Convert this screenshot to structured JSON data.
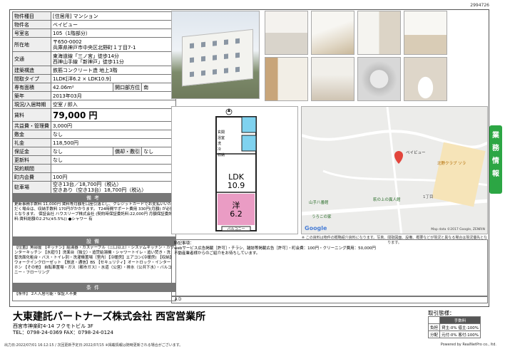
{
  "doc_id": "2994726",
  "property": {
    "rows": [
      {
        "k": "物件種目",
        "v": "[住居用] マンション"
      },
      {
        "k": "物件名",
        "v": "ベイビュー"
      },
      {
        "k": "号室名",
        "v": "105（1階部分）"
      },
      {
        "k": "所在地",
        "v": "〒650-0002\n兵庫県神戸市中央区北野町１丁目7-1"
      },
      {
        "k": "交通",
        "v": "東海道線「三ノ宮」徒歩14分\n西神山手線「新神戸」徒歩11分"
      },
      {
        "k": "建築構造",
        "v": "鉄筋コンクリート造 地上3階"
      },
      {
        "k": "間取タイプ",
        "v": "1LDK[洋6.2 × LDK10.9]"
      },
      {
        "k": "専有面積",
        "v": "42.06m²",
        "k2": "開口部方位",
        "v2": "南"
      },
      {
        "k": "築年",
        "v": "2013年03月"
      },
      {
        "k": "現況/入居時期",
        "v": "空室 / 即入"
      },
      {
        "k": "賃料",
        "v": "79,000 円"
      },
      {
        "k": "共益費・管理費",
        "v": "3,000円"
      },
      {
        "k": "敷金",
        "v": "なし"
      },
      {
        "k": "礼金",
        "v": "118,500円"
      },
      {
        "k": "保証金",
        "v": "なし",
        "k2": "償却・敷引",
        "v2": "なし"
      },
      {
        "k": "更新料",
        "v": "なし"
      },
      {
        "k": "契約期間",
        "v": ""
      },
      {
        "k": "町内会費",
        "v": "100円"
      },
      {
        "k": "駐車場",
        "v": "空き13台／18,700円（税込）\n空きあり（空き13台）18,700円（税込）"
      }
    ]
  },
  "sections": {
    "remarks_title": "備考",
    "remarks_text": "更新事務手数料 11,000円 賃料等月額を口座引落とし、クレジットカードでお支払いいただく場合は、収納手数料 170円がかかります。 T24時間サポート費用 330円(月額) が必要となります。 保証会社 ハウスリーブ株式会社 (契約時保証委託料:22,000円 月額保証委託料:賃料総額の2.2%(※5.5%)) ●シャワー 有",
    "facility_title": "設備",
    "facility_text": "【位置】角部屋 【キッチン】給湯器・ガステーブル（三口以上）・システムキッチン・カウンターキッチン 【水廻り】洗面台（独立）・追焚給湯機・シャワートイレ・追い焚き・洗髪洗面化粧台・バス・トイレ別・洗濯機置場（室内）【冷暖房】エアコン(冷暖房) 【収納】ウォークインクローゼット 【放送・通信】BS 【セキュリティ】オートロック・インターホン 【その他】 自転車置場・ガス（都市ガス）・水道（公営）・排水（公共下水）・バルコニー・フローリング",
    "condition_title": "条件",
    "condition_text": "【条件】 2人入居可能・保証人不要"
  },
  "floorplan": {
    "ldk_label": "LDK",
    "ldk_size": "10.9",
    "room_label": "洋",
    "room_size": "6.2",
    "balcony": "バルコニー",
    "small": [
      "玄関",
      "浴室",
      "洗",
      "冷",
      "収納"
    ]
  },
  "map": {
    "places": [
      "ベイビュー",
      "北野クラブ ソラ",
      "山手八番館",
      "萩の上の異人館",
      "うろこの家",
      "1丁目"
    ],
    "brand": "Google",
    "copyright": "Map data ©2017 Google, ZENRIN"
  },
  "disclaimer": "※ この資料は物件の概略紹介資料になります。写真、間取図面、設備、概要などが現況と異なる場合は現況優先となります。",
  "remarks_box": {
    "label": "特記事項：",
    "line1": "webサービス広告掲載［許可］・チラシ、雑誌等掲載広告［許可］・町会費：100円・クリーニング費用：50,000円",
    "line2": "不動産業者様からのご紹介をお待ちしています。"
  },
  "ad_label": "ＡＤ",
  "side_tab": "業務情報",
  "company": {
    "name": "大東建託パートナーズ株式会社 西宮営業所",
    "address": "西宮市神楽町4-14 フクモトビル 3F",
    "tel": "TEL：0798-24-0369 FAX：0798-24-0124"
  },
  "terms": {
    "label": "取引態様：",
    "header": "手数料",
    "row1_k": "負担",
    "row1_v": "貸主:0% 借主:100%",
    "row2_k": "分配",
    "row2_v": "元付:0% 客付:100%"
  },
  "footer_left": "出力日:2022/07/01 16:12:15 / 次回更新予定日:2022/07/15 ※掲載情報は随時更新される場合がございます。",
  "footer_right": "Powered by RealNetPro co., ltd."
}
